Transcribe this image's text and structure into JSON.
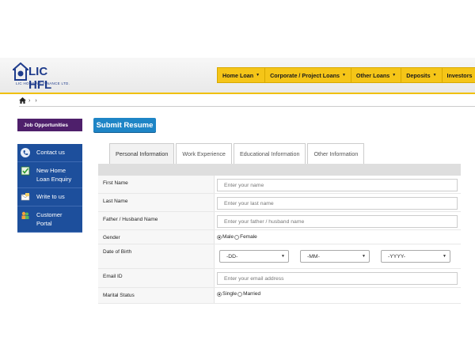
{
  "brand": {
    "logo_text": "LIC HFL",
    "logo_sub": "LIC HOUSING FINANCE LTD.",
    "color_primary": "#1f3c8c",
    "color_nav": "#f5c518"
  },
  "nav": {
    "items": [
      {
        "label": "Home Loan"
      },
      {
        "label": "Corporate / Project Loans"
      },
      {
        "label": "Other Loans"
      },
      {
        "label": "Deposits"
      },
      {
        "label": "Investors"
      }
    ]
  },
  "breadcrumb": {
    "separator1": "›",
    "separator2": "›"
  },
  "sidebar": {
    "heading": "Job Opportunities",
    "items": [
      {
        "label": "Contact us",
        "icon": "phone-icon"
      },
      {
        "label": "New Home Loan Enquiry",
        "icon": "checklist-icon"
      },
      {
        "label": "Write to us",
        "icon": "mail-icon"
      },
      {
        "label": "Customer Portal",
        "icon": "people-icon"
      }
    ]
  },
  "page": {
    "submit_label": "Submit Resume"
  },
  "tabs": [
    {
      "label": "Personal Information",
      "active": true
    },
    {
      "label": "Work Experience",
      "active": false
    },
    {
      "label": "Educational Information",
      "active": false
    },
    {
      "label": "Other Information",
      "active": false
    }
  ],
  "form": {
    "first_name": {
      "label": "First Name",
      "placeholder": "Enter your name"
    },
    "last_name": {
      "label": "Last Name",
      "placeholder": "Enter your last name"
    },
    "father_name": {
      "label": "Father / Husband Name",
      "placeholder": "Enter your father / husband  name"
    },
    "gender": {
      "label": "Gender",
      "options": [
        "Male",
        "Female"
      ],
      "selected": "Male"
    },
    "dob": {
      "label": "Date of Birth",
      "day": "-DD-",
      "month": "-MM-",
      "year": "-YYYY-"
    },
    "email": {
      "label": "Email ID",
      "placeholder": "Enter your email address"
    },
    "marital": {
      "label": "Marital Status",
      "options": [
        "Single",
        "Married"
      ],
      "selected": "Single"
    }
  }
}
